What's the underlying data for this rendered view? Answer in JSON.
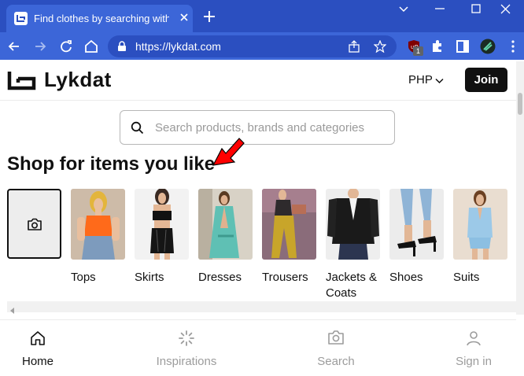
{
  "browser": {
    "tab_title": "Find clothes by searching with im",
    "url": "https://lykdat.com",
    "extension_badge": "1"
  },
  "site": {
    "brand": "Lykdat",
    "currency": "PHP",
    "join_label": "Join",
    "search_placeholder": "Search products, brands and categories",
    "section_title": "Shop for items you like"
  },
  "categories": [
    {
      "label": "Tops"
    },
    {
      "label": "Skirts"
    },
    {
      "label": "Dresses"
    },
    {
      "label": "Trousers"
    },
    {
      "label": "Jackets & Coats"
    },
    {
      "label": "Shoes"
    },
    {
      "label": "Suits"
    }
  ],
  "bottom_nav": [
    {
      "label": "Home",
      "icon": "home-icon",
      "active": true
    },
    {
      "label": "Inspirations",
      "icon": "loading-spinner-icon",
      "active": false
    },
    {
      "label": "Search",
      "icon": "camera-icon",
      "active": false
    },
    {
      "label": "Sign in",
      "icon": "user-icon",
      "active": false
    }
  ],
  "colors": {
    "chrome_dark": "#2b4fc0",
    "chrome_light": "#3c66d8",
    "annotation_arrow": "#ff0000",
    "join_bg": "#111111"
  }
}
